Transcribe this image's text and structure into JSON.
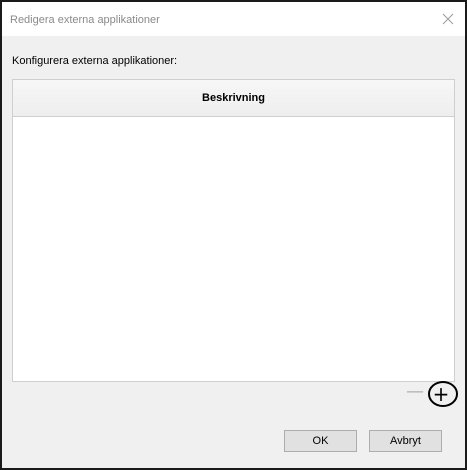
{
  "window": {
    "title": "Redigera externa applikationer",
    "close_glyph": "✕"
  },
  "main": {
    "section_label": "Konfigurera externa applikationer:",
    "list": {
      "column_header": "Beskrivning",
      "items": []
    },
    "remove_glyph": "—",
    "add_glyph": "+"
  },
  "footer": {
    "ok_label": "OK",
    "cancel_label": "Avbryt"
  },
  "colors": {
    "title_text": "#8a8a8a",
    "client_bg": "#f0f0f0",
    "button_bg": "#e1e1e1",
    "annotation_circle": "#000000"
  },
  "icons": {
    "close": "close-icon",
    "remove": "minus-icon",
    "add": "plus-icon"
  }
}
